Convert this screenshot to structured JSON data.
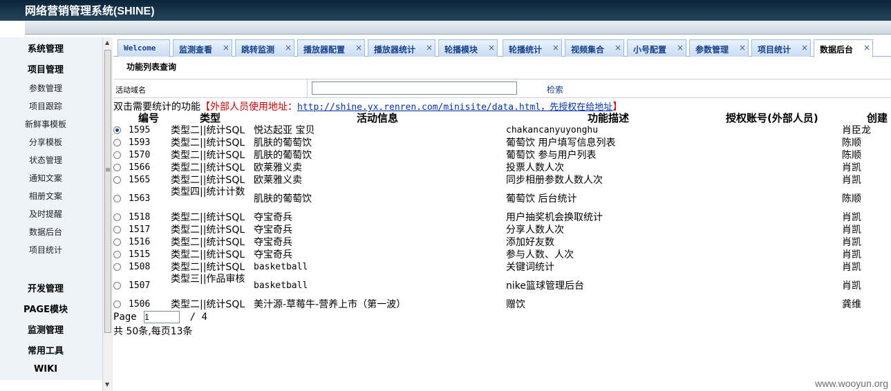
{
  "app": {
    "title": "网络营销管理系统(SHINE)"
  },
  "sidebar": {
    "groups": [
      {
        "label": "系统管理"
      },
      {
        "label": "项目管理"
      },
      {
        "label": "开发管理"
      },
      {
        "label": "PAGE模块"
      },
      {
        "label": "监测管理"
      },
      {
        "label": "常用工具"
      },
      {
        "label": "WIKI"
      }
    ],
    "items": [
      {
        "label": "参数管理"
      },
      {
        "label": "项目跟踪"
      },
      {
        "label": "新鲜事模板"
      },
      {
        "label": "分享模板"
      },
      {
        "label": "状态管理"
      },
      {
        "label": "通知文案"
      },
      {
        "label": "相册文案"
      },
      {
        "label": "及时提醒"
      },
      {
        "label": "数据后台"
      },
      {
        "label": "项目统计"
      }
    ]
  },
  "tabs": [
    {
      "label": "Welcome"
    },
    {
      "label": "监测查看"
    },
    {
      "label": "跳转监测"
    },
    {
      "label": "播放器配置"
    },
    {
      "label": "播放器统计"
    },
    {
      "label": "轮播模块"
    },
    {
      "label": "轮播统计"
    },
    {
      "label": "视频集合"
    },
    {
      "label": "小号配置"
    },
    {
      "label": "参数管理"
    },
    {
      "label": "项目统计"
    },
    {
      "label": "数据后台"
    }
  ],
  "tab_close_glyph": "×",
  "panel": {
    "title": "功能列表查询"
  },
  "search": {
    "label": "活动域名",
    "value": "",
    "button": "检索"
  },
  "notice": {
    "prefix": "双击需要统计的功能",
    "red_open": "【外部人员使用地址：",
    "url": "http://shine.yx.renren.com/minisite/data.html，先授权在给地址",
    "red_close": "】"
  },
  "table": {
    "headers": {
      "id": "编号",
      "type": "类型",
      "activity": "活动信息",
      "desc": "功能描述",
      "account": "授权账号(外部人员)",
      "creator": "创建"
    },
    "rows": [
      {
        "selected": true,
        "id": "1595",
        "type": "类型二||统计SQL",
        "activity": "悦达起亚 宝贝",
        "desc": "chakancanyuyonghu",
        "creator": "肖臣龙"
      },
      {
        "selected": false,
        "id": "1593",
        "type": "类型二||统计SQL",
        "activity": "肌肤的葡萄饮",
        "desc": "葡萄饮 用户填写信息列表",
        "creator": "陈顺"
      },
      {
        "selected": false,
        "id": "1570",
        "type": "类型二||统计SQL",
        "activity": "肌肤的葡萄饮",
        "desc": "葡萄饮 参与用户列表",
        "creator": "陈顺"
      },
      {
        "selected": false,
        "id": "1566",
        "type": "类型二||统计SQL",
        "activity": "欧莱雅义卖",
        "desc": "投票人数人次",
        "creator": "肖凯"
      },
      {
        "selected": false,
        "id": "1565",
        "type": "类型二||统计SQL",
        "activity": "欧莱雅义卖",
        "desc": "同步相册参数人数人次",
        "creator": "肖凯"
      },
      {
        "selected": false,
        "id": "1563",
        "type": "类型四||统计计数",
        "activity": "肌肤的葡萄饮",
        "desc": "葡萄饮 后台统计",
        "creator": "陈顺"
      },
      {
        "selected": false,
        "id": "1518",
        "type": "类型二||统计SQL",
        "activity": "夺宝奇兵",
        "desc": "用户抽奖机会换取统计",
        "creator": "肖凯"
      },
      {
        "selected": false,
        "id": "1517",
        "type": "类型二||统计SQL",
        "activity": "夺宝奇兵",
        "desc": "分享人数人次",
        "creator": "肖凯"
      },
      {
        "selected": false,
        "id": "1516",
        "type": "类型二||统计SQL",
        "activity": "夺宝奇兵",
        "desc": "添加好友数",
        "creator": "肖凯"
      },
      {
        "selected": false,
        "id": "1515",
        "type": "类型二||统计SQL",
        "activity": "夺宝奇兵",
        "desc": "参与人数、人次",
        "creator": "肖凯"
      },
      {
        "selected": false,
        "id": "1508",
        "type": "类型二||统计SQL",
        "activity": "basketball",
        "desc": "关键词统计",
        "creator": "肖凯"
      },
      {
        "selected": false,
        "id": "1507",
        "type": "类型三||作品审核",
        "activity": "basketball",
        "desc": "nike篮球管理后台",
        "creator": "肖凯"
      },
      {
        "selected": false,
        "id": "1506",
        "type": "类型二||统计SQL",
        "activity": "美汁源-草莓牛-营养上市（第一波）",
        "desc": "赠饮",
        "creator": "龚维"
      }
    ]
  },
  "pager": {
    "page_label": "Page",
    "current": "1",
    "of": "/ 4",
    "total": "共 50条,每页13条"
  },
  "watermark": "www.wooyun.org"
}
